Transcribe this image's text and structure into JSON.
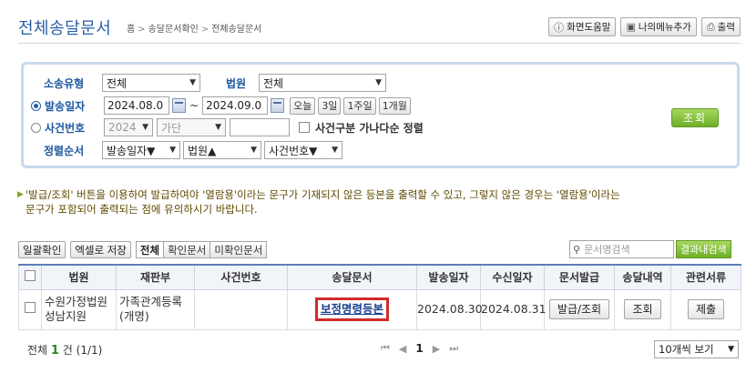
{
  "header": {
    "title": "전체송달문서",
    "breadcrumbs": [
      "홈",
      "송달문서확인",
      "전체송달문서"
    ],
    "buttons": {
      "help": "화면도움말",
      "my_menu": "나의메뉴추가",
      "print": "출력"
    }
  },
  "search": {
    "type_label": "소송유형",
    "type_value": "전체",
    "court_label": "법원",
    "court_value": "전체",
    "date_label": "발송일자",
    "date_from": "2024.08.0",
    "date_tilde": "~",
    "date_to": "2024.09.0",
    "quick": [
      "오늘",
      "3일",
      "1주일",
      "1개월"
    ],
    "case_label": "사건번호",
    "case_year": "2024",
    "case_gubun": "가단",
    "case_sort_label": "사건구분 가나다순 정렬",
    "order_label": "정렬순서",
    "order_opts": [
      "발송일자▼",
      "법원▲",
      "사건번호▼"
    ],
    "submit": "조회"
  },
  "notice": {
    "line1": "'발급/조회' 버튼을 이용하여 발급하여야 '열람용'이라는 문구가 기재되지 않은 등본을 출력할 수 있고, 그렇지 않은 경우는 '열람용'이라는",
    "line2": "문구가 포함되어 출력되는 점에 유의하시기 바랍니다."
  },
  "toolbar": {
    "bulk_confirm": "일괄확인",
    "excel_save": "엑셀로 저장",
    "tabs": [
      "전체",
      "확인문서",
      "미확인문서"
    ],
    "doc_search_placeholder": "문서명검색",
    "result_search": "결과내검색"
  },
  "table": {
    "headers": [
      "법원",
      "재판부",
      "사건번호",
      "송달문서",
      "발송일자",
      "수신일자",
      "문서발급",
      "송달내역",
      "관련서류"
    ],
    "rows": [
      {
        "court": "수원가정법원 성남지원",
        "division": "가족관계등록(개명)",
        "case_no": "",
        "document": "보정명령등본",
        "sent_date": "2024.08.30",
        "recv_date": "2024.08.31",
        "issue_btn": "발급/조회",
        "history_btn": "조회",
        "related_btn": "제출"
      }
    ]
  },
  "footer": {
    "total_prefix": "전체",
    "total_count": "1",
    "total_suffix": "건 (1/1)",
    "page": "1",
    "per_page": "10개씩 보기"
  }
}
